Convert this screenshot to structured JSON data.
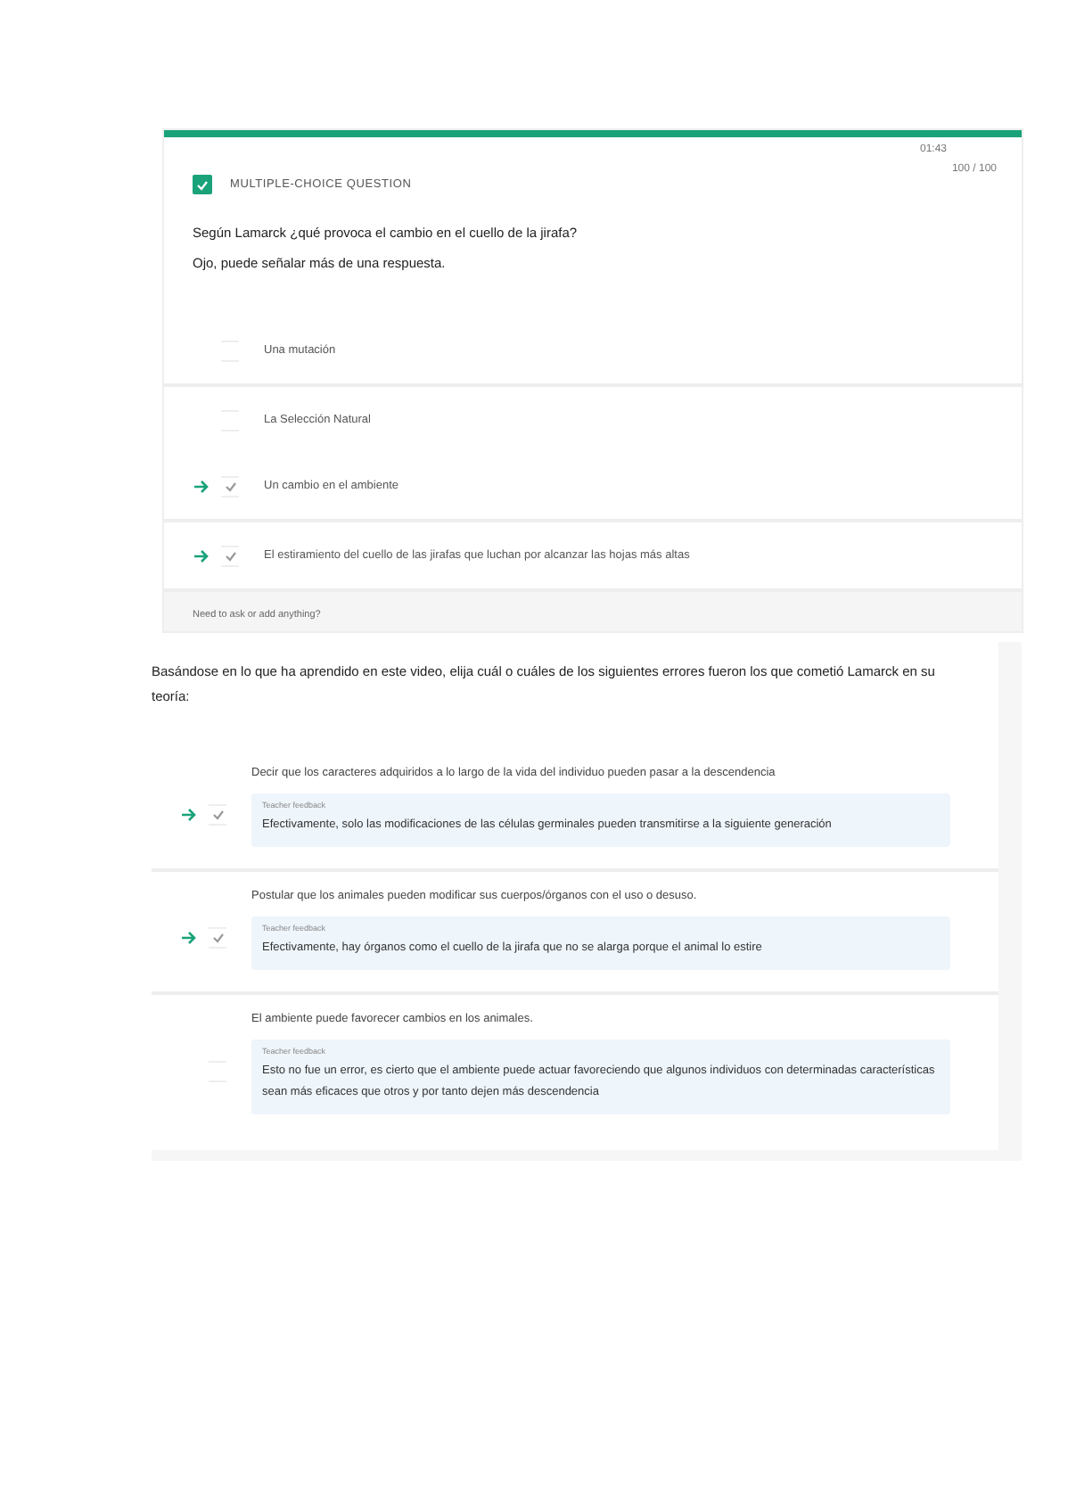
{
  "quiz": {
    "checked": true,
    "type_label": "MULTIPLE-CHOICE QUESTION",
    "timer": "01:43",
    "score": "100 / 100",
    "question": [
      "Según Lamarck ¿qué provoca el cambio en el cuello de la jirafa?",
      "Ojo, puede señalar más de una respuesta."
    ],
    "options": [
      {
        "text": "Una mutación",
        "checked": false,
        "correct": false,
        "divider": true
      },
      {
        "text": "La Selección Natural",
        "checked": false,
        "correct": false,
        "divider": false
      },
      {
        "text": "Un cambio en el ambiente",
        "checked": true,
        "correct": true,
        "divider": true
      },
      {
        "text": "El estiramiento del cuello de las jirafas que luchan por alcanzar las hojas más altas",
        "checked": true,
        "correct": true,
        "divider": true
      }
    ],
    "footer": "Need to ask or add anything?"
  },
  "quiz_2": {
    "question": "Basándose en lo que ha aprendido en este video, elija cuál o cuáles de los siguientes errores fueron los que cometió Lamarck en su teoría:",
    "options": [
      {
        "text": "Decir que los caracteres adquiridos a lo largo de la vida del individuo pueden pasar a la descendencia",
        "checked": true,
        "correct": true,
        "feedback_label": "Teacher feedback",
        "feedback": "Efectivamente, solo las modificaciones de las células germinales pueden transmitirse a la siguiente generación"
      },
      {
        "text": "Postular que los animales pueden modificar sus cuerpos/órganos con el uso o desuso.",
        "checked": true,
        "correct": true,
        "feedback_label": "Teacher feedback",
        "feedback": "Efectivamente, hay órganos como el cuello de la jirafa que no se alarga porque el animal lo estire"
      },
      {
        "text": "El ambiente puede favorecer cambios en los animales.",
        "checked": false,
        "correct": false,
        "feedback_label": "Teacher feedback",
        "feedback": "Esto no fue un error, es cierto que el ambiente puede actuar favoreciendo que algunos individuos con determinadas características sean más eficaces que otros y por tanto dejen más descendencia"
      }
    ]
  }
}
